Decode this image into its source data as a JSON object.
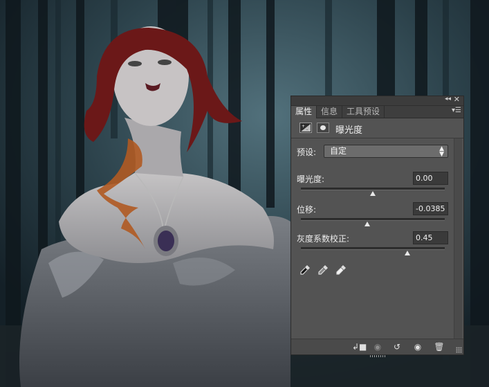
{
  "panel": {
    "tabs": [
      {
        "label": "属性"
      },
      {
        "label": "信息"
      },
      {
        "label": "工具预设"
      }
    ],
    "title": "曝光度",
    "preset": {
      "label": "预设:",
      "value": "自定"
    },
    "controls": [
      {
        "label": "曝光度:",
        "value": "0.00",
        "slider_position": 0.5
      },
      {
        "label": "位移:",
        "value": "-0.0385",
        "slider_position": 0.46
      },
      {
        "label": "灰度系数校正:",
        "value": "0.45",
        "slider_position": 0.74
      }
    ]
  },
  "colors": {
    "panel_bg": "#535353",
    "field_bg": "#3a3a3a",
    "tab_bar": "#3e3e3e"
  },
  "icons": [
    "collapse-icon",
    "close-icon",
    "panel-menu-icon",
    "adjustment-icon",
    "mask-icon",
    "black-eyedropper-icon",
    "gray-eyedropper-icon",
    "white-eyedropper-icon",
    "clip-to-layer-icon",
    "view-previous-icon",
    "reset-icon",
    "visibility-icon",
    "trash-icon"
  ]
}
